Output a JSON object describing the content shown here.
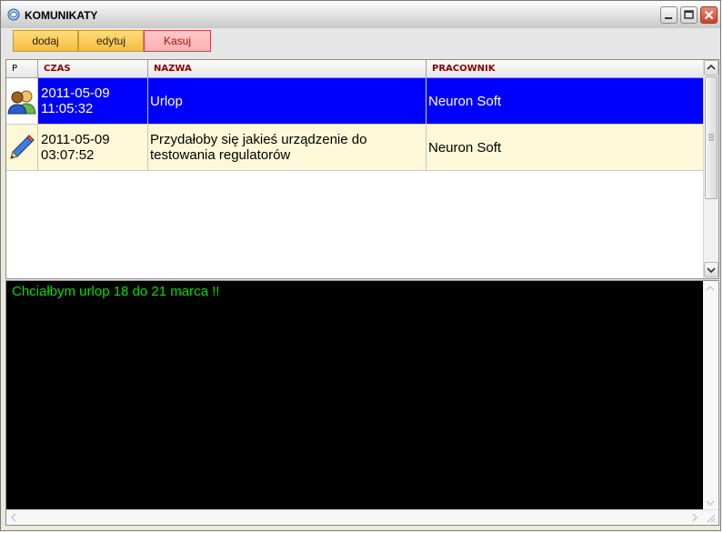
{
  "window": {
    "title": "KOMUNIKATY",
    "icon": "app-icon",
    "controls": [
      "minimize-icon",
      "maximize-icon",
      "close-icon"
    ]
  },
  "toolbar": {
    "add_label": "dodaj",
    "edit_label": "edytuj",
    "delete_label": "Kasuj"
  },
  "grid": {
    "columns": [
      "P",
      "CZAS",
      "NAZWA",
      "PRACOWNIK"
    ],
    "rows": [
      {
        "icon": "users-icon",
        "date": "2011-05-09",
        "time": "11:05:32",
        "name_line1": "Urlop",
        "name_line2": "",
        "employee": "Neuron Soft",
        "selected": true
      },
      {
        "icon": "pencil-icon",
        "date": "2011-05-09",
        "time": "03:07:52",
        "name_line1": "Przydałoby się jakieś urządzenie do",
        "name_line2": "testowania regulatorów",
        "employee": "Neuron Soft",
        "selected": false
      }
    ]
  },
  "message": {
    "text": "Chciałbym urlop 18 do 21 marca !!"
  },
  "colors": {
    "selected_row": "#0000ff",
    "row_bg": "#fdf8d8",
    "header_text": "#8b0000",
    "message_text": "#00e000",
    "message_bg": "#000000",
    "button_orange": "#f5bd40",
    "button_delete": "#ffb0b0"
  }
}
